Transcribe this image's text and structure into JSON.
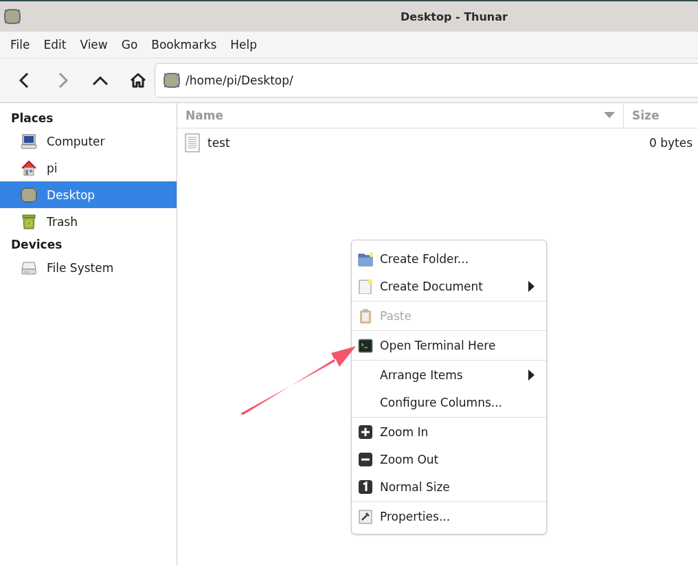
{
  "window": {
    "title": "Desktop - Thunar"
  },
  "menu_bar": [
    "File",
    "Edit",
    "View",
    "Go",
    "Bookmarks",
    "Help"
  ],
  "toolbar": {
    "back": {
      "disabled": false
    },
    "forward": {
      "disabled": true
    },
    "location": "/home/pi/Desktop/"
  },
  "sidebar": [
    {
      "heading": "Places",
      "items": [
        {
          "label": "Computer",
          "selected": false
        },
        {
          "label": "pi",
          "selected": false
        },
        {
          "label": "Desktop",
          "selected": true
        },
        {
          "label": "Trash",
          "selected": false
        }
      ]
    },
    {
      "heading": "Devices",
      "items": [
        {
          "label": "File System",
          "selected": false
        }
      ]
    }
  ],
  "table": {
    "columns": [
      {
        "label": "Name",
        "sorted": true
      },
      {
        "label": "Size",
        "sorted": false
      }
    ],
    "rows": [
      {
        "name": "test",
        "size": "0 bytes"
      }
    ]
  },
  "context_menu": [
    [
      {
        "label": "Create Folder...",
        "disabled": false,
        "submenu": false
      },
      {
        "label": "Create Document",
        "disabled": false,
        "submenu": true
      }
    ],
    [
      {
        "label": "Paste",
        "disabled": true,
        "submenu": false
      }
    ],
    [
      {
        "label": "Open Terminal Here",
        "disabled": false,
        "submenu": false
      }
    ],
    [
      {
        "label": "Arrange Items",
        "disabled": false,
        "submenu": true
      },
      {
        "label": "Configure Columns...",
        "disabled": false,
        "submenu": false
      }
    ],
    [
      {
        "label": "Zoom In",
        "disabled": false,
        "submenu": false
      },
      {
        "label": "Zoom Out",
        "disabled": false,
        "submenu": false
      },
      {
        "label": "Normal Size",
        "disabled": false,
        "submenu": false
      }
    ],
    [
      {
        "label": "Properties...",
        "disabled": false,
        "submenu": false
      }
    ]
  ]
}
